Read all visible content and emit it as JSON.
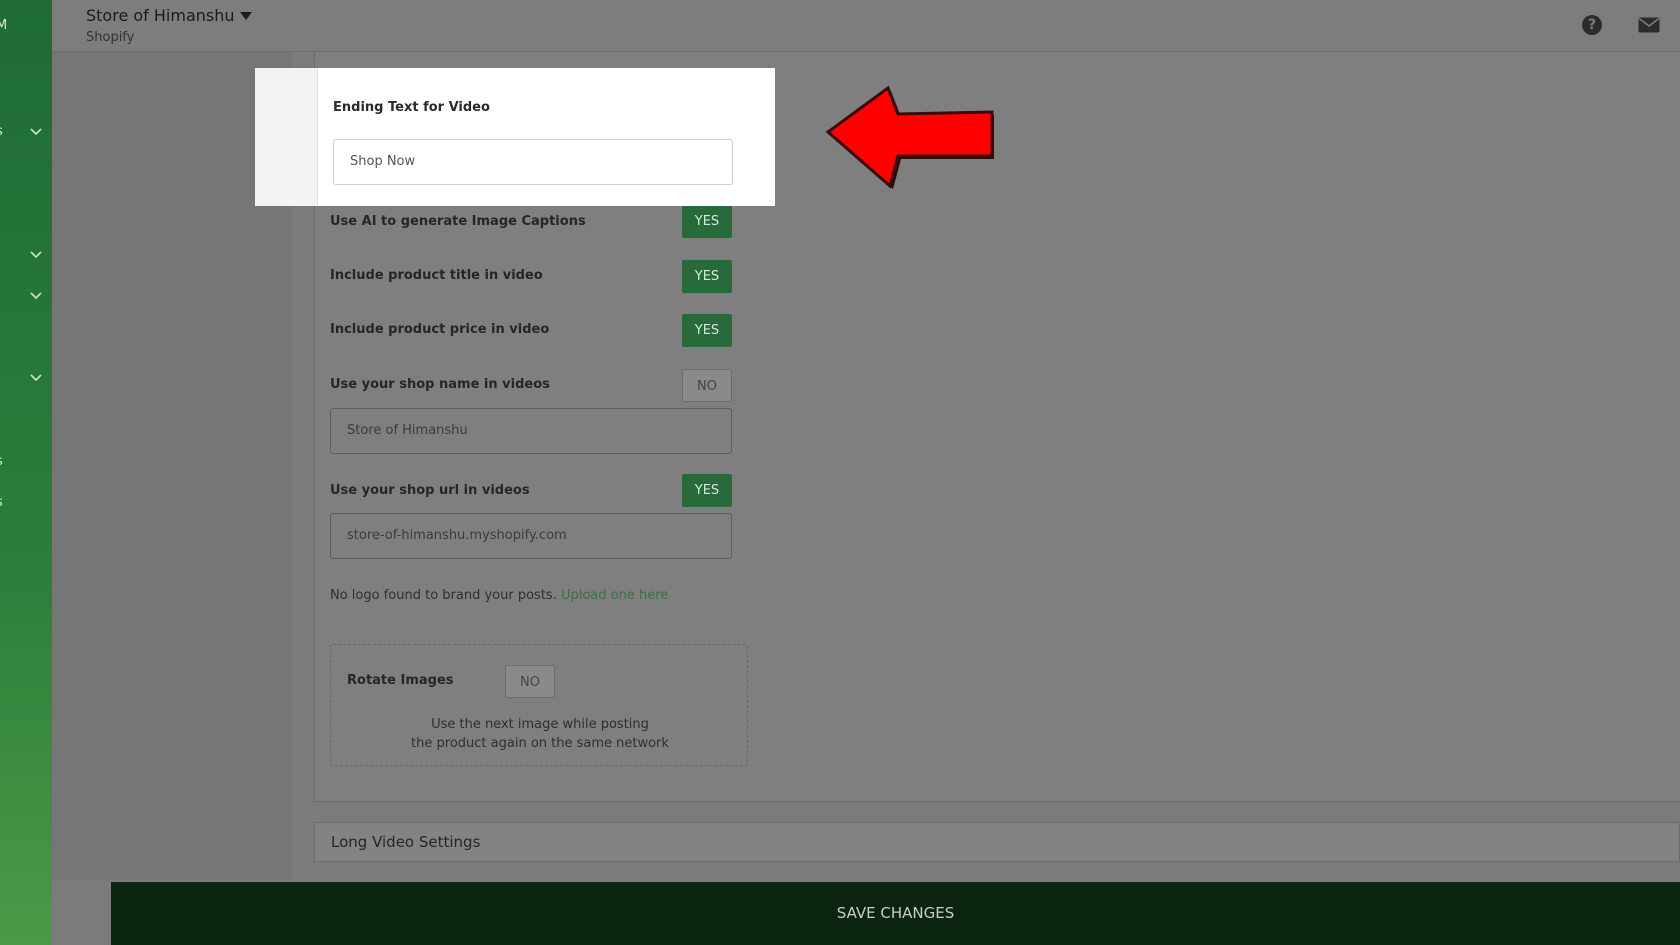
{
  "header": {
    "store_name": "Store of Himanshu",
    "platform": "Shopify"
  },
  "ending_text": {
    "label": "Ending Text for Video",
    "value": "Shop Now"
  },
  "settings": [
    {
      "label": "Use AI to generate Image Captions",
      "toggle": "YES"
    },
    {
      "label": "Include product title in video",
      "toggle": "YES"
    },
    {
      "label": "Include product price in video",
      "toggle": "YES"
    },
    {
      "label": "Use your shop name in videos",
      "toggle": "NO",
      "field_value": "Store of  Himanshu"
    },
    {
      "label": "Use your shop url in videos",
      "toggle": "YES",
      "field_value": "store-of-himanshu.myshopify.com"
    }
  ],
  "logo_note": {
    "text": "No logo found to brand your posts.",
    "link": "Upload one here"
  },
  "rotate": {
    "label": "Rotate Images",
    "toggle": "NO",
    "desc_line1": "Use the next image while posting",
    "desc_line2": "the product again on the same network"
  },
  "long_video": {
    "title": "Long Video Settings"
  },
  "save_label": "SAVE CHANGES",
  "colors": {
    "sidebar_green": "#2b7e3b",
    "toggle_yes": "#276b3a",
    "arrow_red": "#ff0000",
    "save_bar": "#0b2410"
  }
}
